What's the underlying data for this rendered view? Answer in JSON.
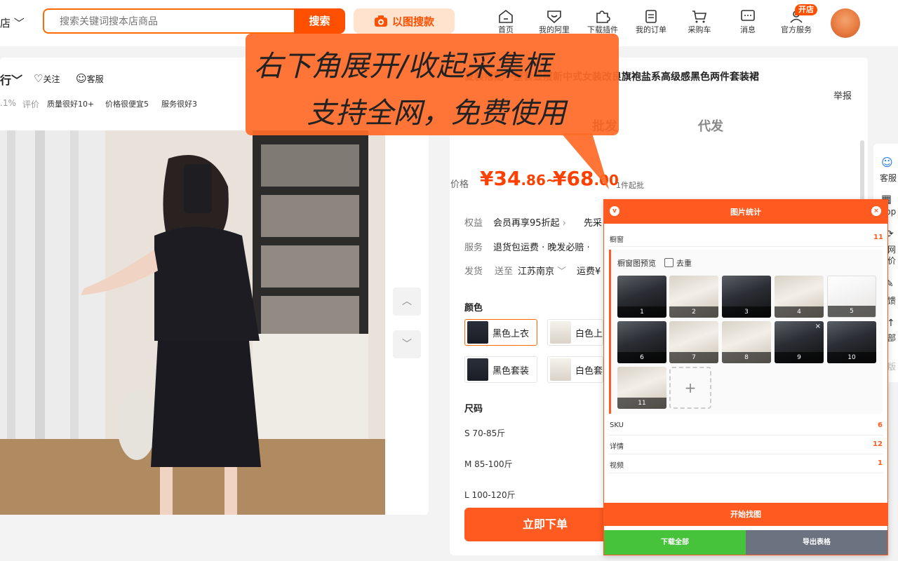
{
  "header": {
    "store_dropdown": "店",
    "search_placeholder": "搜索关键词搜本店商品",
    "search_button": "搜索",
    "image_search": "以图搜款",
    "nav": [
      {
        "label": "首页",
        "icon": "home-icon"
      },
      {
        "label": "我的阿里",
        "icon": "heart-shield-icon"
      },
      {
        "label": "下载插件",
        "icon": "puzzle-icon"
      },
      {
        "label": "我的订单",
        "icon": "order-icon"
      },
      {
        "label": "采购车",
        "icon": "cart-icon"
      },
      {
        "label": "消息",
        "icon": "message-icon"
      },
      {
        "label": "官方服务",
        "icon": "service-person-icon"
      }
    ],
    "open_badge": "开店"
  },
  "shop": {
    "name": "行",
    "follow": "关注",
    "service": "客服",
    "rate": ".1%",
    "eval_label": "评价",
    "tags": [
      "质量很好10+",
      "价格很便宜5",
      "服务很好3"
    ]
  },
  "product": {
    "title": "夏装搭配一整套显瘦新中式女装改良旗袍盐系高级感黑色两件套装裙",
    "report": "举报",
    "tabs": {
      "wholesale": "批发",
      "dropship": "代发"
    },
    "price_label": "价格",
    "price_low_int": "¥34",
    "price_low_dec": ".86",
    "price_sep": "~",
    "price_high_int": "¥68",
    "price_high_dec": ".00",
    "moq": "1件起批",
    "rights_label": "权益",
    "rights_value": "会员再享95折起",
    "rights_more": "先采",
    "service_label": "服务",
    "service_value": "退货包运费 · 晚发必赔 ·",
    "ship_label": "发货",
    "ship_to": "送至",
    "ship_city": "江苏南京",
    "ship_fee": "运费¥",
    "color_label": "颜色",
    "colors": [
      "黑色上衣",
      "白色上",
      "黑色套装",
      "白色套"
    ],
    "size_label": "尺码",
    "sizes": [
      "S 70-85斤",
      "M 85-100斤",
      "L 100-120斤"
    ],
    "order_button": "立即下单"
  },
  "side_tools": [
    "客服",
    "pp",
    "网价",
    "馈",
    "部",
    "版"
  ],
  "promo": {
    "line1": "右下角展开/收起采集框",
    "line2": "支持全网，免费使用"
  },
  "panel": {
    "title": "图片统计",
    "window_label": "橱窗",
    "window_count": "11",
    "preview_label": "橱窗图预览",
    "dedupe_label": "去重",
    "thumbs": [
      "1",
      "2",
      "3",
      "4",
      "5",
      "6",
      "7",
      "8",
      "9",
      "10",
      "11"
    ],
    "add": "+",
    "rows": [
      {
        "label": "SKU",
        "count": "6"
      },
      {
        "label": "详情",
        "count": "12"
      },
      {
        "label": "视频",
        "count": "1"
      }
    ],
    "start_button": "开始找图",
    "download_button": "下载全部",
    "export_button": "导出表格"
  },
  "colors": {
    "accent": "#ff5000",
    "panel_orange": "#ff5a1f",
    "green": "#46c33a",
    "gray": "#6b7280"
  }
}
